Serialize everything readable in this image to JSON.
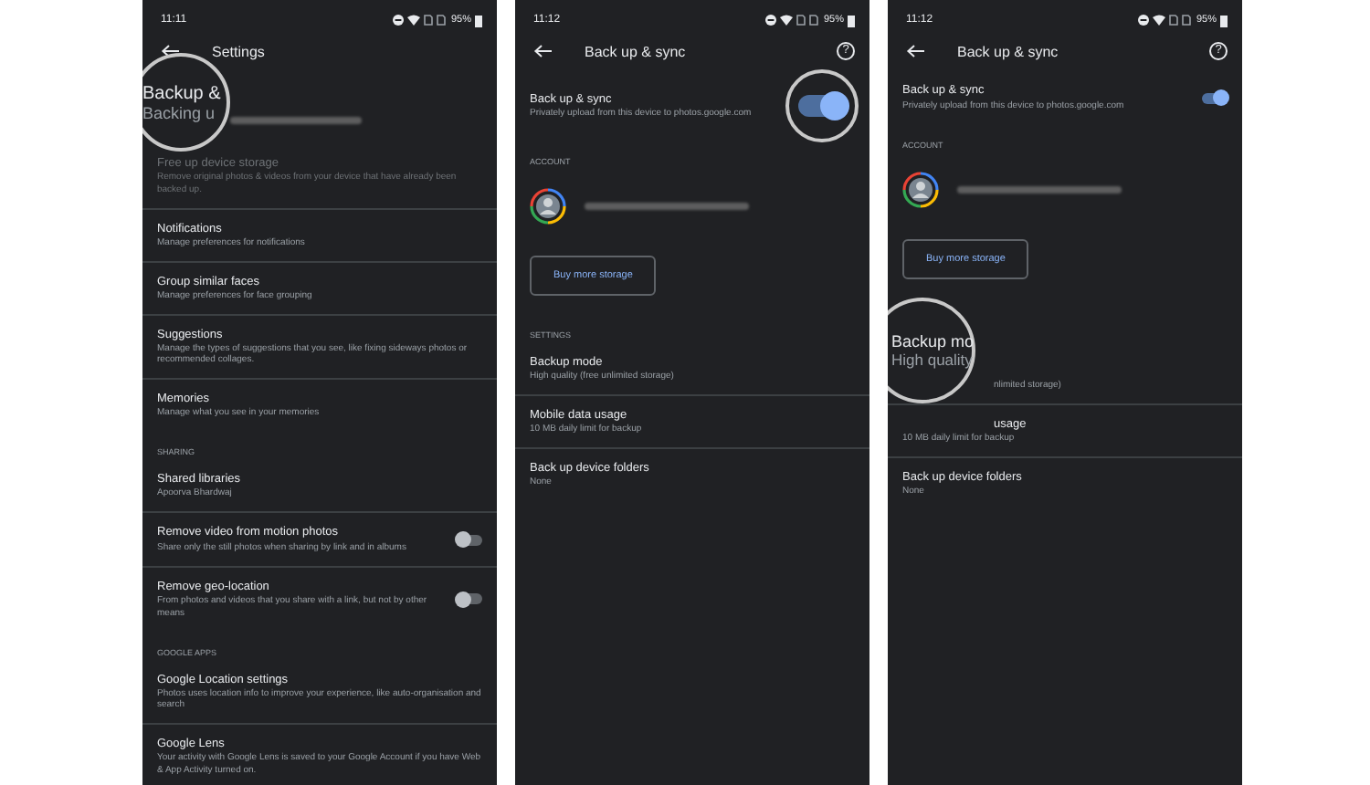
{
  "panels": [
    {
      "time": "11:11",
      "battery": "95%",
      "title": "Settings",
      "items": [
        {
          "kind": "lens-status",
          "title": "Backup &",
          "subtitle": "Backing u"
        },
        {
          "kind": "row",
          "title": "Free up device storage",
          "subtitle": "Remove original photos & videos from your device that have already been backed up.",
          "disabled": true
        },
        {
          "kind": "row",
          "title": "Notifications",
          "subtitle": "Manage preferences for notifications",
          "disabled": false
        },
        {
          "kind": "row",
          "title": "Group similar faces",
          "subtitle": "Manage preferences for face grouping",
          "disabled": false
        },
        {
          "kind": "row",
          "title": "Suggestions",
          "subtitle": "Manage the types of suggestions that you see, like fixing sideways photos or recommended collages.",
          "disabled": false
        },
        {
          "kind": "row",
          "title": "Memories",
          "subtitle": "Manage what you see in your memories",
          "disabled": false
        },
        {
          "kind": "header",
          "title": "SHARING"
        },
        {
          "kind": "row",
          "title": "Shared libraries",
          "subtitle": "Apoorva Bhardwaj",
          "disabled": false
        },
        {
          "kind": "toggle",
          "title": "Remove video from motion photos",
          "subtitle": "Share only the still photos when sharing by link and in albums",
          "on": false,
          "magnified": false
        },
        {
          "kind": "toggle",
          "title": "Remove geo-location",
          "subtitle": "From photos and videos that you share with a link, but not by other means",
          "on": false,
          "magnified": false
        },
        {
          "kind": "header",
          "title": "GOOGLE APPS"
        },
        {
          "kind": "row",
          "title": "Google Location settings",
          "subtitle": "Photos uses location info to improve your experience, like auto-organisation and search",
          "disabled": false
        },
        {
          "kind": "row",
          "title": "Google Lens",
          "subtitle": "Your activity with Google Lens is saved to your Google Account if you have Web & App Activity turned on.",
          "disabled": false
        }
      ]
    },
    {
      "time": "11:12",
      "battery": "95%",
      "title": "Back up & sync",
      "help": "?",
      "items": [
        {
          "kind": "toggle",
          "title": "Back up & sync",
          "subtitle": "Privately upload from this device to photos.google.com",
          "on": true,
          "magnified": true
        },
        {
          "kind": "header",
          "title": "ACCOUNT"
        },
        {
          "kind": "account"
        },
        {
          "kind": "button",
          "title": "Buy more storage"
        },
        {
          "kind": "header",
          "title": "SETTINGS"
        },
        {
          "kind": "row",
          "title": "Backup mode",
          "subtitle": "High quality (free unlimited storage)",
          "disabled": false
        },
        {
          "kind": "row",
          "title": "Mobile data usage",
          "subtitle": "10 MB daily limit for backup",
          "disabled": false
        },
        {
          "kind": "row",
          "title": "Back up device folders",
          "subtitle": "None",
          "disabled": false
        }
      ]
    },
    {
      "time": "11:12",
      "battery": "95%",
      "title": "Back up & sync",
      "help": "?",
      "items": [
        {
          "kind": "toggle",
          "title": "Back up & sync",
          "subtitle": "Privately upload from this device to photos.google.com",
          "on": true,
          "magnified": false
        },
        {
          "kind": "header",
          "title": "ACCOUNT"
        },
        {
          "kind": "account"
        },
        {
          "kind": "button",
          "title": "Buy more storage"
        },
        {
          "kind": "lens-row",
          "title": "Backup mo",
          "subtitle": "High quality",
          "rest": "nlimited storage)"
        },
        {
          "kind": "row-covered",
          "title": "usage",
          "subtitle": "10 MB daily limit for backup"
        },
        {
          "kind": "row",
          "title": "Back up device folders",
          "subtitle": "None",
          "disabled": false
        }
      ]
    }
  ]
}
